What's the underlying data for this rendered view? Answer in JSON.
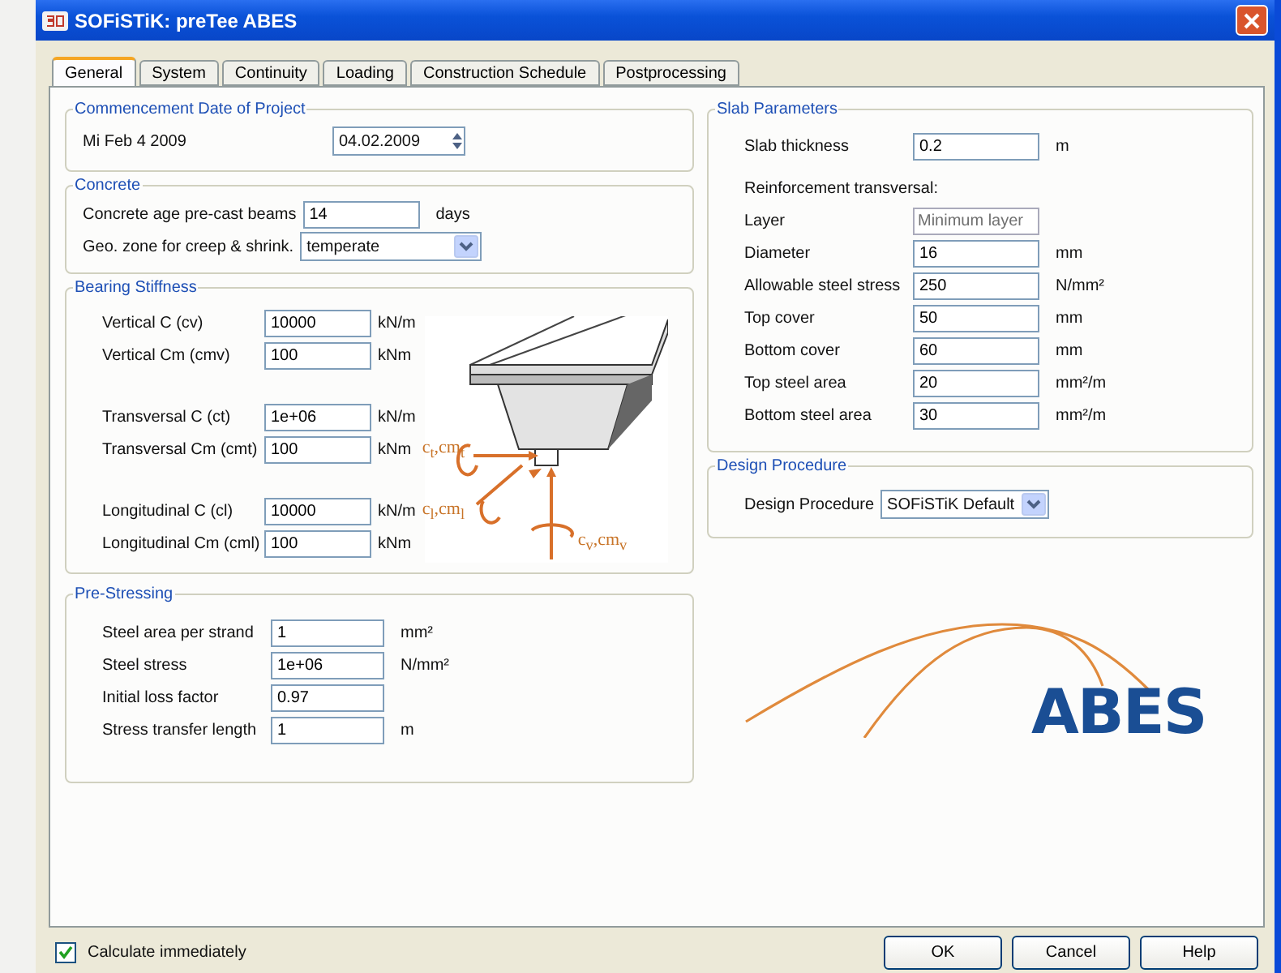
{
  "window": {
    "title": "SOFiSTiK: preTee ABES"
  },
  "tabs": [
    {
      "label": "General",
      "selected": true
    },
    {
      "label": "System",
      "selected": false
    },
    {
      "label": "Continuity",
      "selected": false
    },
    {
      "label": "Loading",
      "selected": false
    },
    {
      "label": "Construction Schedule",
      "selected": false
    },
    {
      "label": "Postprocessing",
      "selected": false
    }
  ],
  "commencement": {
    "title": "Commencement Date of Project",
    "date_text": "Mi Feb 4 2009",
    "date_value": "04.02.2009"
  },
  "concrete": {
    "title": "Concrete",
    "rows": [
      {
        "kind": "field",
        "label": "Concrete age pre-cast beams",
        "value": "14",
        "unit": "days"
      },
      {
        "kind": "select",
        "label": "Geo. zone for creep & shrink.",
        "value": "temperate"
      }
    ]
  },
  "bearing_stiffness": {
    "title": "Bearing Stiffness",
    "groups": [
      [
        {
          "label": "Vertical C  (cv)",
          "value": "10000",
          "unit": "kN/m"
        },
        {
          "label": "Vertical Cm (cmv)",
          "value": "100",
          "unit": "kNm"
        }
      ],
      [
        {
          "label": "Transversal C  (ct)",
          "value": "1e+06",
          "unit": "kN/m"
        },
        {
          "label": "Transversal Cm (cmt)",
          "value": "100",
          "unit": "kNm"
        }
      ],
      [
        {
          "label": "Longitudinal C  (cl)",
          "value": "10000",
          "unit": "kN/m"
        },
        {
          "label": "Longitudinal Cm (cml)",
          "value": "100",
          "unit": "kNm"
        }
      ]
    ],
    "diagram_labels": [
      "c$_{t}$,cm$_{t}$",
      "c$_{l}$,cm$_{l}$",
      "c$_{v}$,cm$_{v}$"
    ]
  },
  "pre_stressing": {
    "title": "Pre-Stressing",
    "rows": [
      {
        "label": "Steel area per strand",
        "value": "1",
        "unit": "mm²"
      },
      {
        "label": "Steel stress",
        "value": "1e+06",
        "unit": "N/mm²"
      },
      {
        "label": "Initial loss factor",
        "value": "0.97"
      },
      {
        "label": "Stress transfer length",
        "value": "1",
        "unit": "m"
      }
    ]
  },
  "slab_parameters": {
    "title": "Slab Parameters",
    "rows": [
      {
        "kind": "field",
        "label": "Slab thickness",
        "value": "0.2",
        "unit": "m",
        "disabled": false
      },
      {
        "kind": "note",
        "label": "Reinforcement transversal:"
      },
      {
        "kind": "field",
        "label": "Layer",
        "value": "Minimum layer",
        "disabled": true
      },
      {
        "kind": "field",
        "label": "Diameter",
        "value": "16",
        "unit": "mm",
        "disabled": false
      },
      {
        "kind": "field",
        "label": "Allowable steel stress",
        "value": "250",
        "unit": "N/mm²",
        "disabled": false
      },
      {
        "kind": "field",
        "label": "Top cover",
        "value": "50",
        "unit": "mm",
        "disabled": false
      },
      {
        "kind": "field",
        "label": "Bottom cover",
        "value": "60",
        "unit": "mm",
        "disabled": false
      },
      {
        "kind": "field",
        "label": "Top steel area",
        "value": "20",
        "unit": "mm²/m",
        "disabled": false
      },
      {
        "kind": "field",
        "label": "Bottom steel area",
        "value": "30",
        "unit": "mm²/m",
        "disabled": false
      }
    ]
  },
  "design_procedure": {
    "title": "Design Procedure",
    "label": "Design Procedure",
    "value": "SOFiSTiK Default"
  },
  "logo": {
    "text": "ABES"
  },
  "footer": {
    "calculate": {
      "label": "Calculate immediately",
      "checked": true
    },
    "buttons": [
      "OK",
      "Cancel",
      "Help"
    ]
  }
}
